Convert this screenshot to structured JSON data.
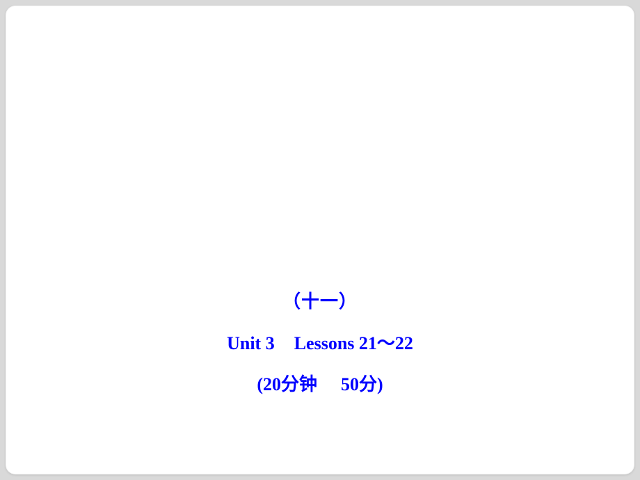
{
  "slide": {
    "line1": "（十一）",
    "line2": {
      "unit": "Unit 3",
      "lessons": "Lessons 21～22"
    },
    "line3": {
      "time": "(20分钟",
      "score": "50分)"
    }
  }
}
